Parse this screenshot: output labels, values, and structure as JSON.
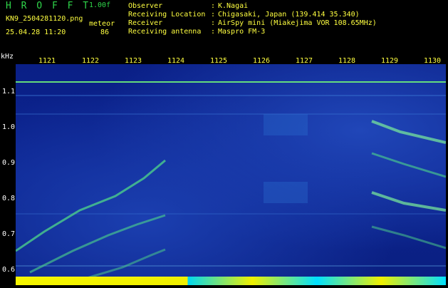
{
  "header": {
    "app_title": "H R O F F T",
    "version": "1.00f",
    "filename": "KN9_2504281120.png",
    "meteor_label": "meteor",
    "datetime": "25.04.28 11:20",
    "meteor_count": "86",
    "info": [
      {
        "label": "Observer",
        "value": "K.Nagai"
      },
      {
        "label": "Receiving Location",
        "value": "Chigasaki, Japan (139.414 35.340)"
      },
      {
        "label": "Receiver",
        "value": "AirSpy mini (Miakejima VOR 108.65MHz)"
      },
      {
        "label": "Receiving antenna",
        "value": "Maspro FM-3"
      }
    ]
  },
  "axis": {
    "unit": "kHz",
    "x_ticks": [
      "1121",
      "1122",
      "1123",
      "1124",
      "1125",
      "1126",
      "1127",
      "1128",
      "1129",
      "1130"
    ],
    "y_ticks": [
      "1.1",
      "1.0",
      "0.9",
      "0.8",
      "0.7",
      "0.6"
    ]
  },
  "colors": {
    "background": "#000000",
    "text_green": "#2fd64a",
    "text_yellow": "#ffff40",
    "spectrogram_blue": "#0c2490",
    "carrier_green": "#6ef07a",
    "bar_yellow": "#f0f000",
    "bar_cyan": "#00e0ff"
  }
}
